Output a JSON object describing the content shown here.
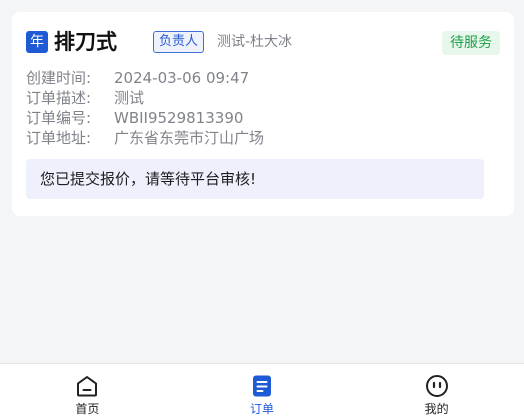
{
  "order": {
    "year_badge": "年",
    "title": "排刀式",
    "role_badge": "负责人",
    "owner": "测试-杜大冰",
    "status": "待服务",
    "fields": [
      {
        "label": "创建时间:",
        "value": "2024-03-06 09:47"
      },
      {
        "label": "订单描述:",
        "value": "测试"
      },
      {
        "label": "订单编号:",
        "value": "WBII9529813390"
      },
      {
        "label": "订单地址:",
        "value": "广东省东莞市汀山广场"
      }
    ],
    "notice": "您已提交报价，请等待平台审核!"
  },
  "tabbar": {
    "items": [
      {
        "label": "首页",
        "icon": "home-icon",
        "active": false
      },
      {
        "label": "订单",
        "icon": "order-icon",
        "active": true
      },
      {
        "label": "我的",
        "icon": "profile-icon",
        "active": false
      }
    ]
  },
  "colors": {
    "accent": "#1f5ad6",
    "status_green": "#1fa14a",
    "status_green_bg": "#e8f7ec",
    "notice_bg": "#eef1fb",
    "page_bg": "#f4f5f7"
  }
}
